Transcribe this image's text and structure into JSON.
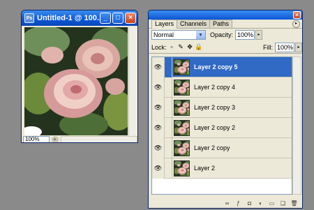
{
  "document": {
    "title": "Untitled-1 @ 100...",
    "zoom": "100%",
    "ps_icon": "Ps",
    "minimize_glyph": "_",
    "maximize_glyph": "□",
    "close_glyph": "×"
  },
  "palette": {
    "close_glyph": "×",
    "menu_glyph": "▸",
    "tabs": [
      "Layers",
      "Channels",
      "Paths"
    ],
    "active_tab": "Layers",
    "blend_mode": "Normal",
    "blend_arrow_glyph": "▼",
    "opacity_label": "Opacity:",
    "opacity_value": "100%",
    "lock_label": "Lock:",
    "fill_label": "Fill:",
    "fill_value": "100%",
    "spin_glyph": "▸",
    "lock_icons": [
      "lock-transparency-icon",
      "lock-image-icon",
      "lock-position-icon",
      "lock-all-icon"
    ],
    "lock_glyphs": [
      "▫",
      "✎",
      "✥",
      "🔒"
    ],
    "eye_glyph": "👁",
    "layers": [
      {
        "name": "Layer 2 copy 5",
        "selected": true
      },
      {
        "name": "Layer 2 copy 4",
        "selected": false
      },
      {
        "name": "Layer 2 copy 3",
        "selected": false
      },
      {
        "name": "Layer 2 copy 2",
        "selected": false
      },
      {
        "name": "Layer 2 copy",
        "selected": false
      },
      {
        "name": "Layer 2",
        "selected": false
      }
    ],
    "bottom_icons": [
      "link-layers-icon",
      "layer-style-icon",
      "layer-mask-icon",
      "adjustment-layer-icon",
      "new-group-icon",
      "new-layer-icon",
      "trash-icon"
    ],
    "bottom_glyphs": [
      "∞",
      "ƒ",
      "◘",
      "◐",
      "▭",
      "❏",
      "🗑"
    ]
  },
  "colors": {
    "desktop": "#8a8a8a",
    "titlebar": "#0b56d6",
    "selection": "#316ac5",
    "panel": "#ece9d8"
  }
}
